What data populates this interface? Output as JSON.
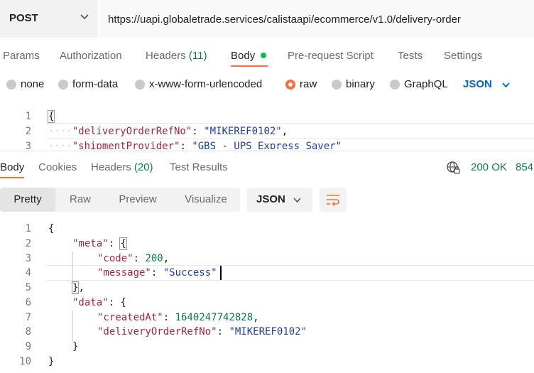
{
  "request": {
    "method": "POST",
    "url": "https://uapi.globaletrade.services/calistaapi/ecommerce/v1.0/delivery-order",
    "tabs": [
      {
        "label": "Params"
      },
      {
        "label": "Authorization"
      },
      {
        "label": "Headers",
        "count": "(11)"
      },
      {
        "label": "Body"
      },
      {
        "label": "Pre-request Script"
      },
      {
        "label": "Tests"
      },
      {
        "label": "Settings"
      }
    ],
    "active_tab": "Body",
    "body_types": [
      "none",
      "form-data",
      "x-www-form-urlencoded",
      "raw",
      "binary",
      "GraphQL"
    ],
    "selected_body_type": "raw",
    "language": "JSON",
    "editor_lines": [
      {
        "n": "1",
        "text": "{"
      },
      {
        "n": "2",
        "key": "\"deliveryOrderRefNo\"",
        "value": "\"MIKEREF0102\""
      },
      {
        "n": "3",
        "key": "\"shipmentProvider\"",
        "value": "\"GBS - UPS Express Saver\""
      }
    ]
  },
  "response": {
    "tabs": [
      {
        "label": "Body"
      },
      {
        "label": "Cookies"
      },
      {
        "label": "Headers",
        "count": "(20)"
      },
      {
        "label": "Test Results"
      }
    ],
    "active_tab": "Body",
    "status": "200 OK",
    "size": "854",
    "views": [
      "Pretty",
      "Raw",
      "Preview",
      "Visualize"
    ],
    "active_view": "Pretty",
    "format": "JSON",
    "line_numbers": [
      "1",
      "2",
      "3",
      "4",
      "5",
      "6",
      "7",
      "8",
      "9",
      "10"
    ],
    "json": {
      "meta_key": "\"meta\"",
      "code_key": "\"code\"",
      "code_value": "200",
      "message_key": "\"message\"",
      "message_value": "\"Success\"",
      "data_key": "\"data\"",
      "created_key": "\"createdAt\"",
      "created_value": "1640247742828",
      "ref_key": "\"deliveryOrderRefNo\"",
      "ref_value": "\"MIKEREF0102\""
    }
  },
  "colors": {
    "accent": "#ff6c37",
    "success": "#0c7e4a",
    "link": "#0265d2",
    "json_key": "#a1263f",
    "json_string": "#1f3e9e",
    "json_number": "#0c7e4a"
  },
  "icons": [
    "chevron-down-icon",
    "globe-icon",
    "wrap-lines-icon"
  ]
}
